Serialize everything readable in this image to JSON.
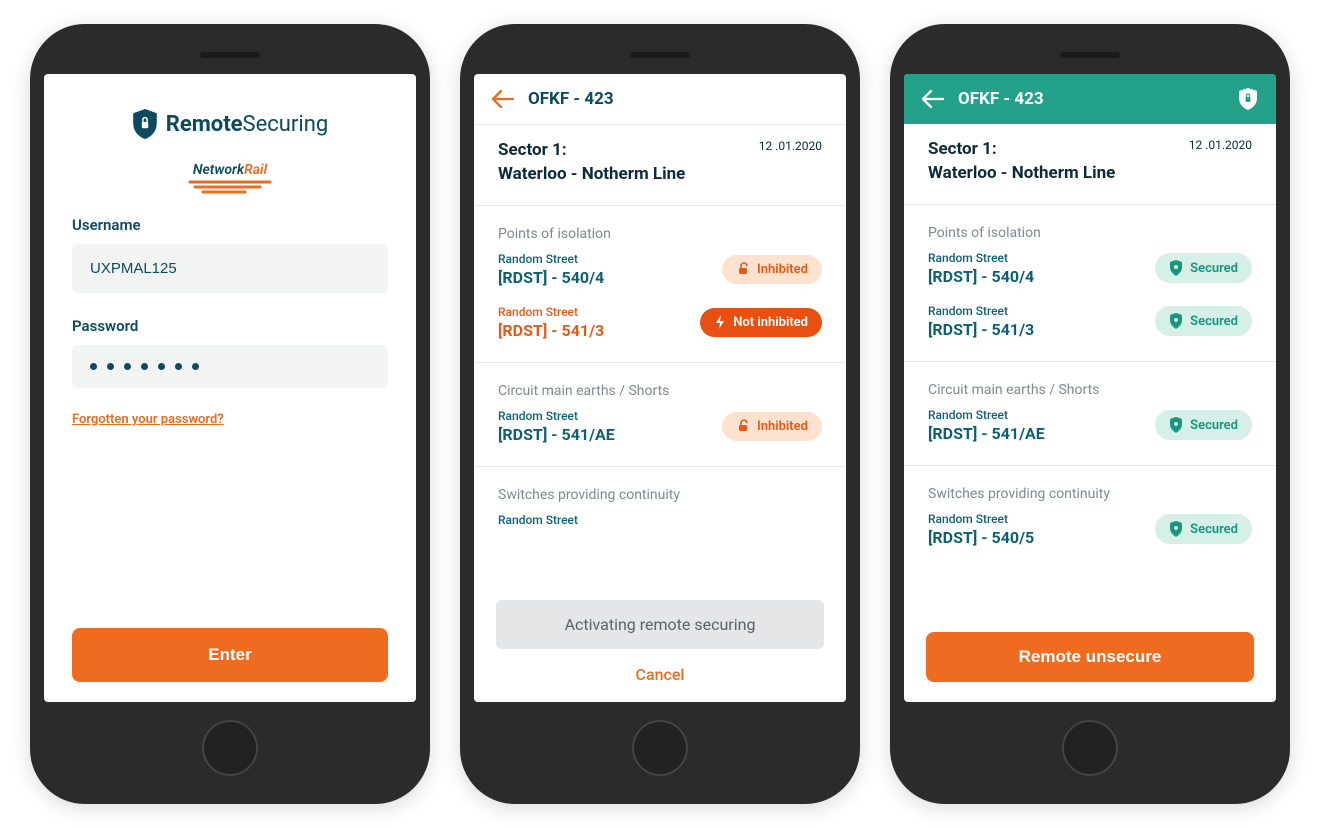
{
  "login": {
    "app_title_bold": "Remote",
    "app_title_light": "Securing",
    "network_rail": "NetworkRail",
    "username_label": "Username",
    "username_value": "UXPMAL125",
    "password_label": "Password",
    "forgot_link": "Forgotten your password?",
    "enter_button": "Enter"
  },
  "screen2": {
    "header_title": "OFKF - 423",
    "sector_title_line1": "Sector 1:",
    "sector_title_line2": "Waterloo - Notherm Line",
    "date": "12 .01.2020",
    "section_poi": "Points of isolation",
    "poi": [
      {
        "street": "Random Street",
        "code": "[RDST] - 540/4",
        "status": "Inhibited",
        "variant": "inhibited"
      },
      {
        "street": "Random Street",
        "code": "[RDST] - 541/3",
        "status": "Not inhibited",
        "variant": "notinhibited"
      }
    ],
    "section_circuit": "Circuit main earths / Shorts",
    "circuit": [
      {
        "street": "Random Street",
        "code": "[RDST] - 541/AE",
        "status": "Inhibited",
        "variant": "inhibited"
      }
    ],
    "section_switches": "Switches providing continuity",
    "switches_street": "Random Street",
    "activating": "Activating remote securing",
    "cancel": "Cancel"
  },
  "screen3": {
    "header_title": "OFKF - 423",
    "sector_title_line1": "Sector 1:",
    "sector_title_line2": "Waterloo - Notherm Line",
    "date": "12 .01.2020",
    "section_poi": "Points of isolation",
    "poi": [
      {
        "street": "Random Street",
        "code": "[RDST] - 540/4",
        "status": "Secured"
      },
      {
        "street": "Random Street",
        "code": "[RDST] - 541/3",
        "status": "Secured"
      }
    ],
    "section_circuit": "Circuit main earths / Shorts",
    "circuit": [
      {
        "street": "Random Street",
        "code": "[RDST] - 541/AE",
        "status": "Secured"
      }
    ],
    "section_switches": "Switches providing continuity",
    "switches": [
      {
        "street": "Random Street",
        "code": "[RDST] - 540/5",
        "status": "Secured"
      }
    ],
    "unsecure_button": "Remote unsecure"
  }
}
